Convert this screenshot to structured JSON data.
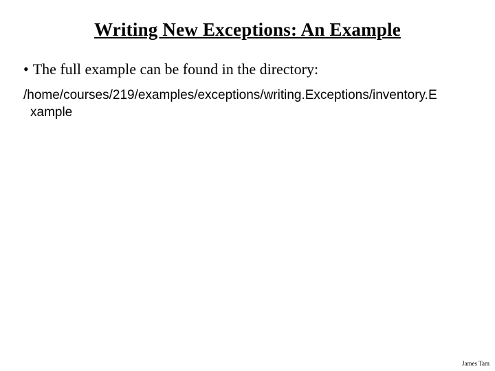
{
  "title": "Writing New Exceptions: An Example",
  "bullet": {
    "marker": "•",
    "text": "The full example can be found in the directory:"
  },
  "path": {
    "line1": "/home/courses/219/examples/exceptions/writing.Exceptions/inventory.E",
    "line2": "xample"
  },
  "footer": "James Tam"
}
